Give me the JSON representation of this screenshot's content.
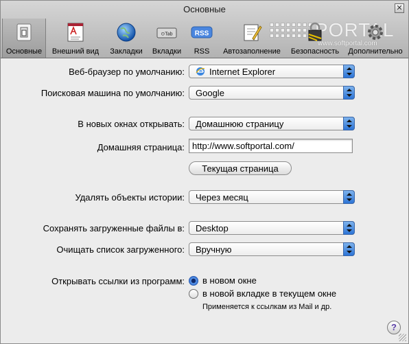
{
  "window": {
    "title": "Основные",
    "close_glyph": "✕"
  },
  "watermark": {
    "text": "PORTAL",
    "sub": "www.softportal.com"
  },
  "tabs": [
    {
      "label": "Основные",
      "icon": "light-switch-icon",
      "active": true
    },
    {
      "label": "Внешний вид",
      "icon": "font-book-icon",
      "active": false
    },
    {
      "label": "Закладки",
      "icon": "globe-icon",
      "active": false
    },
    {
      "label": "Вкладки",
      "icon": "tabs-icon",
      "active": false
    },
    {
      "label": "RSS",
      "icon": "rss-icon",
      "active": false
    },
    {
      "label": "Автозаполнение",
      "icon": "autofill-pen-icon",
      "active": false
    },
    {
      "label": "Безопасность",
      "icon": "security-lock-icon",
      "active": false
    },
    {
      "label": "Дополнительно",
      "icon": "gear-icon",
      "active": false
    }
  ],
  "rss_icon_text": "RSS",
  "tabs_icon_text": "⊙Tab",
  "form": {
    "default_browser_label": "Веб-браузер по умолчанию:",
    "default_browser_value": "Internet Explorer",
    "search_engine_label": "Поисковая машина по умолчанию:",
    "search_engine_value": "Google",
    "new_windows_label": "В новых окнах открывать:",
    "new_windows_value": "Домашнюю страницу",
    "homepage_label": "Домашняя страница:",
    "homepage_value": "http://www.softportal.com/",
    "current_page_button": "Текущая страница",
    "history_label": "Удалять объекты истории:",
    "history_value": "Через месяц",
    "downloads_label": "Сохранять загруженные файлы в:",
    "downloads_value": "Desktop",
    "clear_downloads_label": "Очищать список загруженного:",
    "clear_downloads_value": "Вручную",
    "open_links_label": "Открывать ссылки из программ:",
    "open_links_options": [
      {
        "label": "в новом окне",
        "selected": true
      },
      {
        "label": "в новой вкладке в текущем окне",
        "selected": false
      }
    ],
    "open_links_note": "Применяется к ссылкам из Mail и др."
  },
  "help_glyph": "?"
}
